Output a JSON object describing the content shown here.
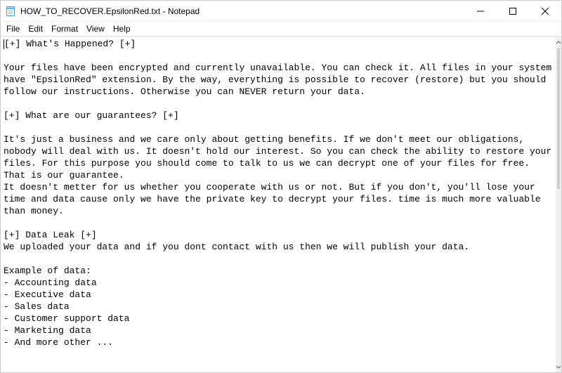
{
  "titlebar": {
    "title": "HOW_TO_RECOVER.EpsilonRed.txt - Notepad"
  },
  "menu": {
    "items": [
      "File",
      "Edit",
      "Format",
      "View",
      "Help"
    ]
  },
  "document": {
    "text": "[+] What's Happened? [+]\n\nYour files have been encrypted and currently unavailable. You can check it. All files in your system have \"EpsilonRed\" extension. By the way, everything is possible to recover (restore) but you should follow our instructions. Otherwise you can NEVER return your data.\n\n[+] What are our guarantees? [+]\n\nIt's just a business and we care only about getting benefits. If we don't meet our obligations, nobody will deal with us. It doesn't hold our interest. So you can check the ability to restore your files. For this purpose you should come to talk to us we can decrypt one of your files for free. That is our guarantee.\nIt doesn't metter for us whether you cooperate with us or not. But if you don't, you'll lose your time and data cause only we have the private key to decrypt your files. time is much more valuable than money.\n\n[+] Data Leak [+]\nWe uploaded your data and if you dont contact with us then we will publish your data.\n\nExample of data:\n- Accounting data\n- Executive data\n- Sales data\n- Customer support data\n- Marketing data\n- And more other ..."
  }
}
